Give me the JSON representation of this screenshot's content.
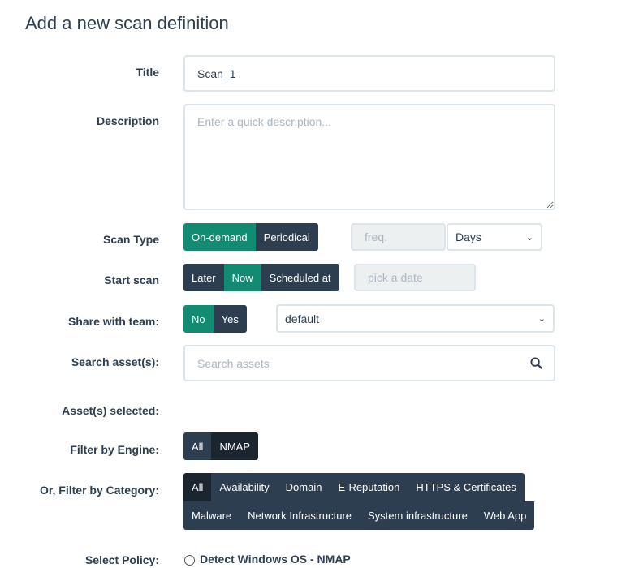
{
  "page": {
    "title": "Add a new scan definition"
  },
  "form": {
    "title_label": "Title",
    "title_value": "Scan_1",
    "description_label": "Description",
    "description_placeholder": "Enter a quick description...",
    "scan_type_label": "Scan Type",
    "scan_type_options": [
      "On-demand",
      "Periodical"
    ],
    "scan_type_selected": "On-demand",
    "freq_placeholder": "freq.",
    "freq_unit": "Days",
    "start_scan_label": "Start scan",
    "start_scan_options": [
      "Later",
      "Now",
      "Scheduled at"
    ],
    "start_scan_selected": "Now",
    "date_placeholder": "pick a date",
    "share_label": "Share with team:",
    "share_options": [
      "No",
      "Yes"
    ],
    "share_selected": "No",
    "team_value": "default",
    "search_label": "Search asset(s):",
    "search_placeholder": "Search assets",
    "assets_selected_label": "Asset(s) selected:",
    "filter_engine_label": "Filter by Engine:",
    "engine_options": [
      "All",
      "NMAP"
    ],
    "filter_category_label": "Or, Filter by Category:",
    "category_row1": [
      "All",
      "Availability",
      "Domain",
      "E-Reputation",
      "HTTPS & Certificates"
    ],
    "category_row2": [
      "Malware",
      "Network Infrastructure",
      "System infrastructure",
      "Web App"
    ],
    "select_policy_label": "Select Policy:",
    "policy_option": "Detect Windows OS - NMAP"
  },
  "colors": {
    "primary": "#2c3e50",
    "success": "#138a72",
    "input_border": "#dce4ec",
    "disabled_bg": "#ecf0f1"
  }
}
